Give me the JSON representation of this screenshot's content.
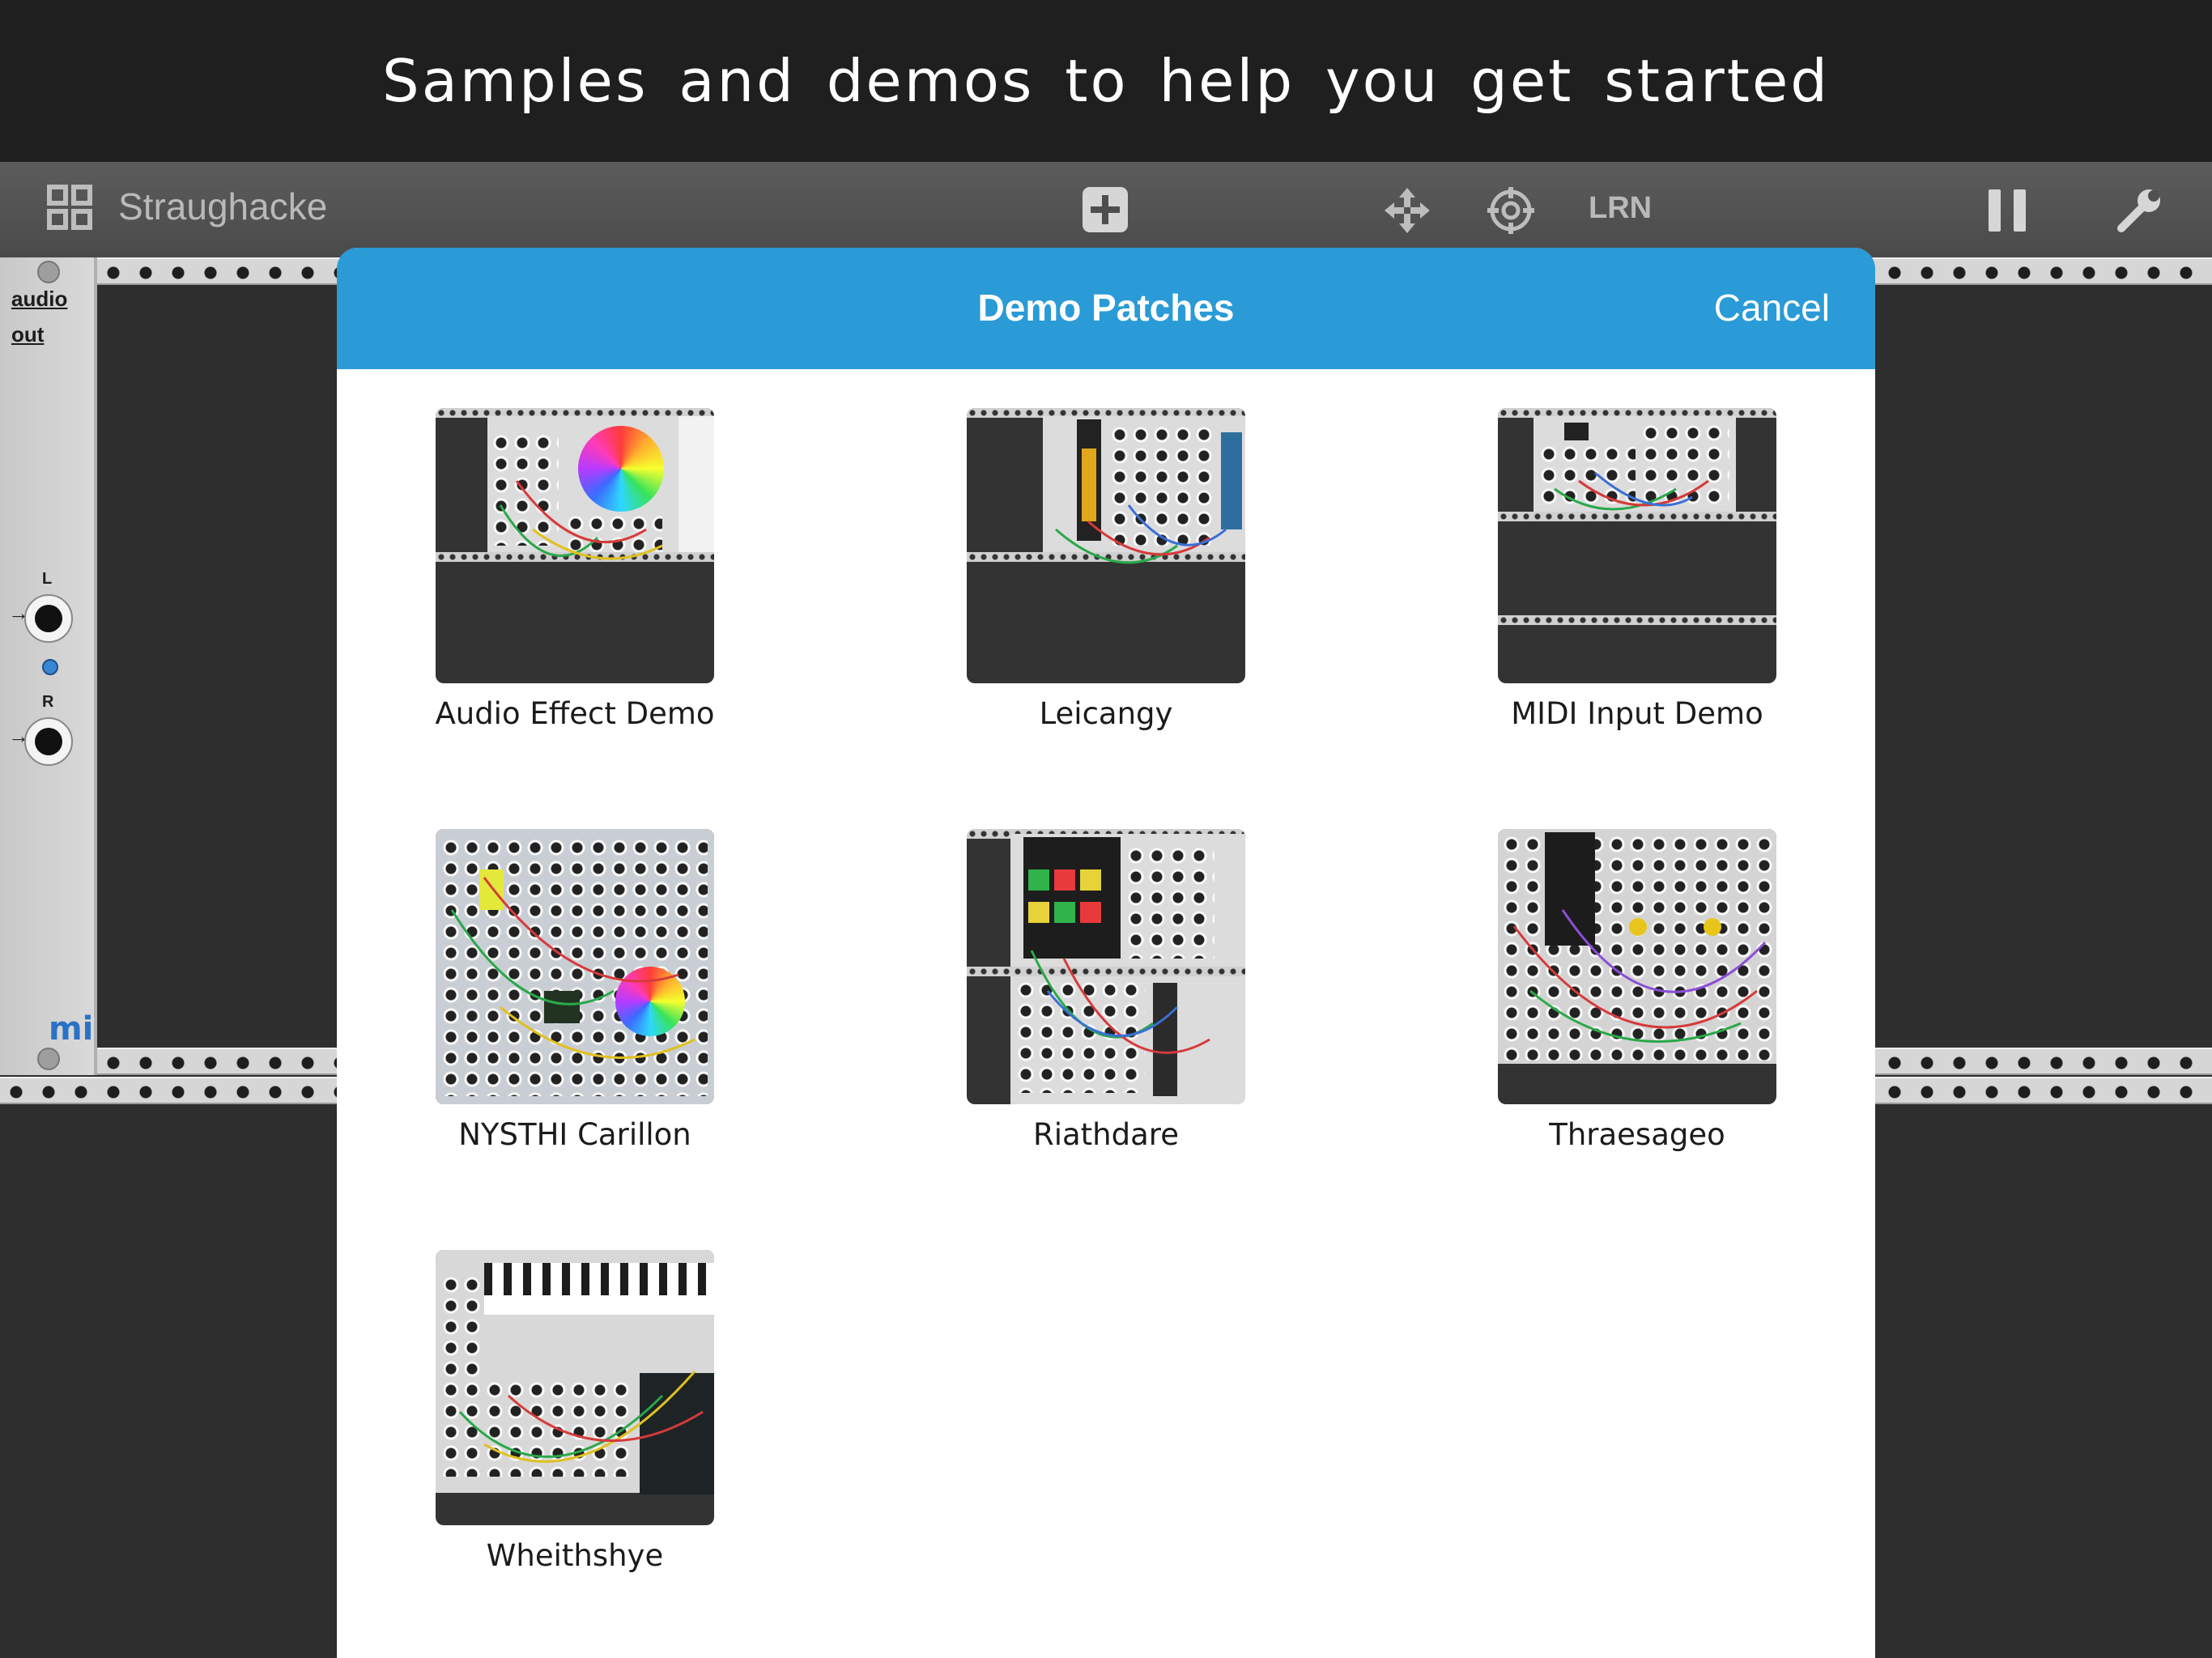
{
  "banner": {
    "text": "Samples and demos to help you get started"
  },
  "toolbar": {
    "patch_name": "Straughacke",
    "learn_label": "LRN"
  },
  "module": {
    "title_line1": "audio",
    "title_line2": "out",
    "left_label": "L",
    "right_label": "R",
    "logo": "mi"
  },
  "dialog": {
    "title": "Demo Patches",
    "cancel_label": "Cancel",
    "patches": [
      {
        "label": "Audio Effect Demo"
      },
      {
        "label": "Leicangy"
      },
      {
        "label": "MIDI Input Demo"
      },
      {
        "label": "NYSTHI Carillon"
      },
      {
        "label": "Riathdare"
      },
      {
        "label": "Thraesageo"
      },
      {
        "label": "Wheithshye"
      }
    ]
  },
  "colors": {
    "accent": "#2a9bd6",
    "banner_bg": "#1f1f1f",
    "toolbar_bg": "#505050",
    "rack_bg": "#2e2e2e"
  },
  "icons": [
    "grid-icon",
    "add-module-icon",
    "move-icon",
    "target-icon",
    "pause-icon",
    "wrench-icon"
  ]
}
